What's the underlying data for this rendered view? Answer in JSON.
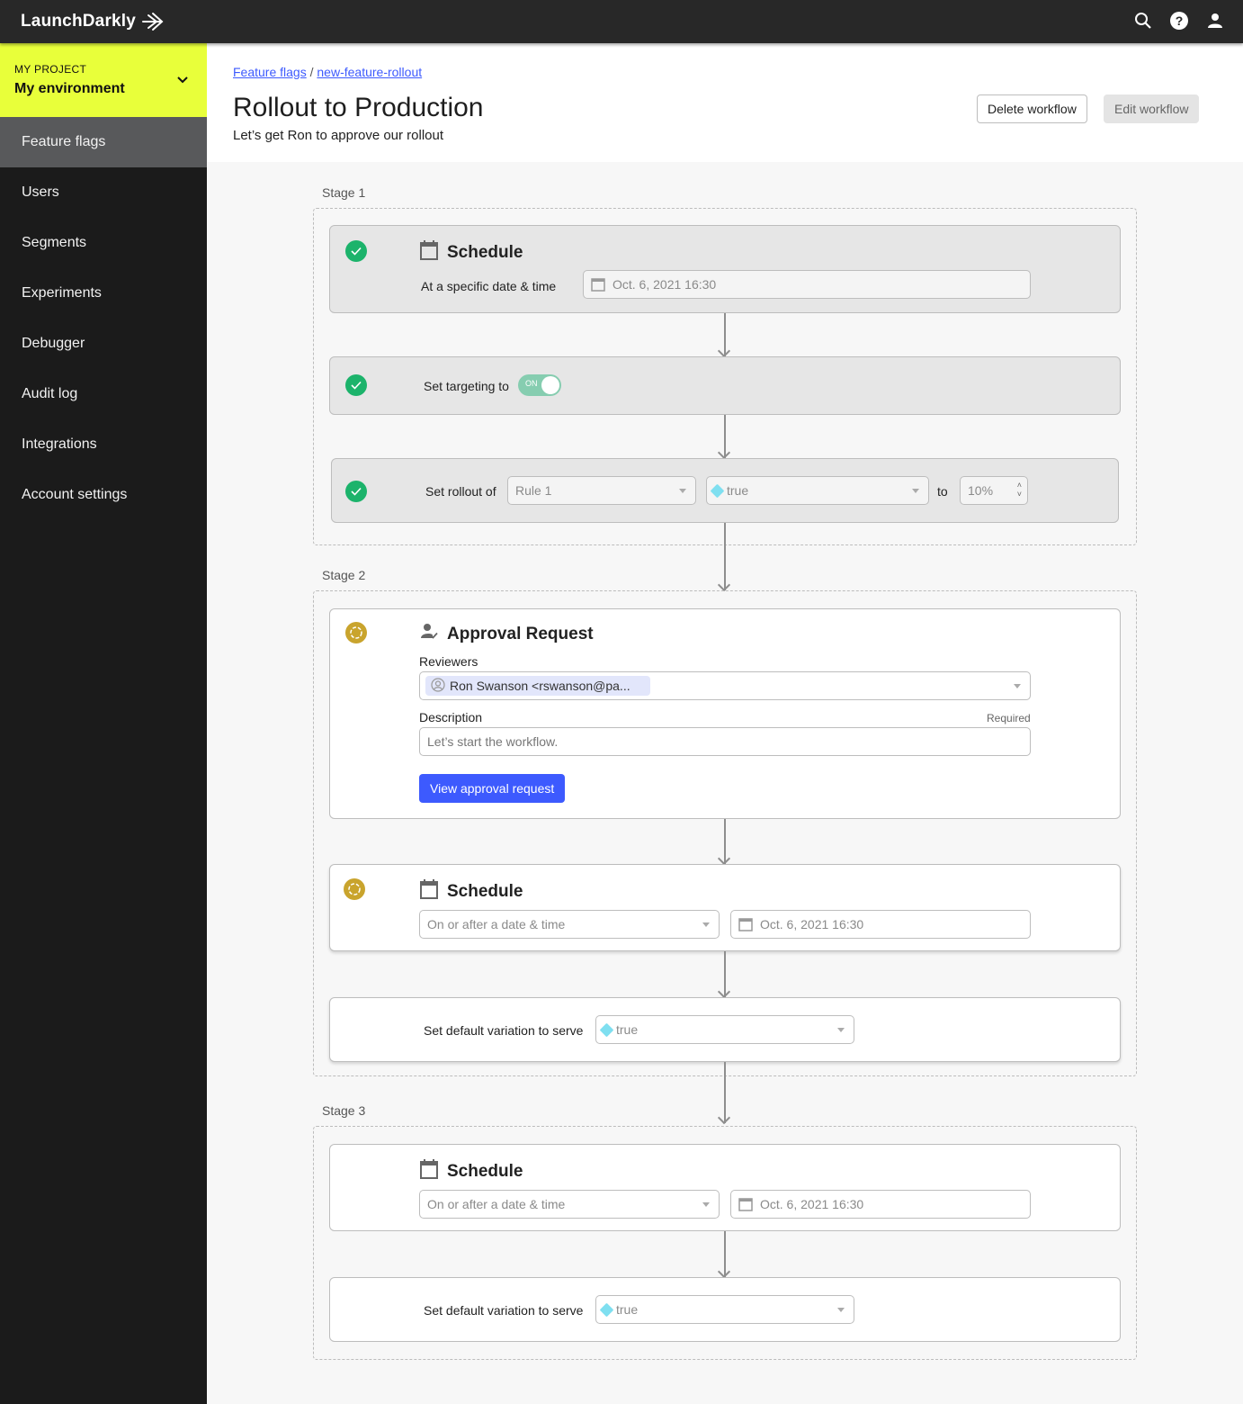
{
  "app": {
    "name": "LaunchDarkly"
  },
  "topbar": {
    "icons": [
      "search-icon",
      "help-icon",
      "account-icon"
    ]
  },
  "sidebar": {
    "project_label": "MY PROJECT",
    "environment": "My environment",
    "items": [
      {
        "label": "Feature flags",
        "active": true
      },
      {
        "label": "Users"
      },
      {
        "label": "Segments"
      },
      {
        "label": "Experiments"
      },
      {
        "label": "Debugger"
      },
      {
        "label": "Audit log"
      },
      {
        "label": "Integrations"
      },
      {
        "label": "Account settings"
      }
    ]
  },
  "header": {
    "breadcrumb": [
      "Feature flags",
      "new-feature-rollout"
    ],
    "breadcrumb_sep": "/",
    "title": "Rollout to Production",
    "subtitle": "Let’s get Ron to approve our rollout",
    "delete_label": "Delete workflow",
    "edit_label": "Edit workflow"
  },
  "stages": [
    {
      "label": "Stage 1",
      "schedule": {
        "title": "Schedule",
        "label": "At a specific date & time",
        "datetime": "Oct. 6, 2021 16:30",
        "status": "complete"
      },
      "targeting": {
        "label": "Set targeting to",
        "toggle": "ON",
        "status": "complete"
      },
      "rollout": {
        "label": "Set rollout of",
        "rule": "Rule 1",
        "variation": "true",
        "to_label": "to",
        "percent": "10%",
        "status": "complete"
      }
    },
    {
      "label": "Stage 2",
      "approval": {
        "title": "Approval Request",
        "reviewers_label": "Reviewers",
        "reviewer": "Ron Swanson <rswanson@pa...",
        "description_label": "Description",
        "required_label": "Required",
        "description_value": "Let’s start the workflow.",
        "button_label": "View approval request",
        "status": "pending"
      },
      "schedule": {
        "title": "Schedule",
        "condition": "On or after a date & time",
        "datetime": "Oct. 6, 2021 16:30",
        "status": "pending"
      },
      "default_variation": {
        "label": "Set default variation to serve",
        "value": "true"
      }
    },
    {
      "label": "Stage 3",
      "schedule": {
        "title": "Schedule",
        "condition": "On or after a date & time",
        "datetime": "Oct. 6, 2021 16:30"
      },
      "default_variation": {
        "label": "Set default variation to serve",
        "value": "true"
      }
    }
  ],
  "colors": {
    "accent": "#3d5afe",
    "env_highlight": "#e8ff3a",
    "success": "#1cb36b",
    "pending": "#c9a42d"
  }
}
